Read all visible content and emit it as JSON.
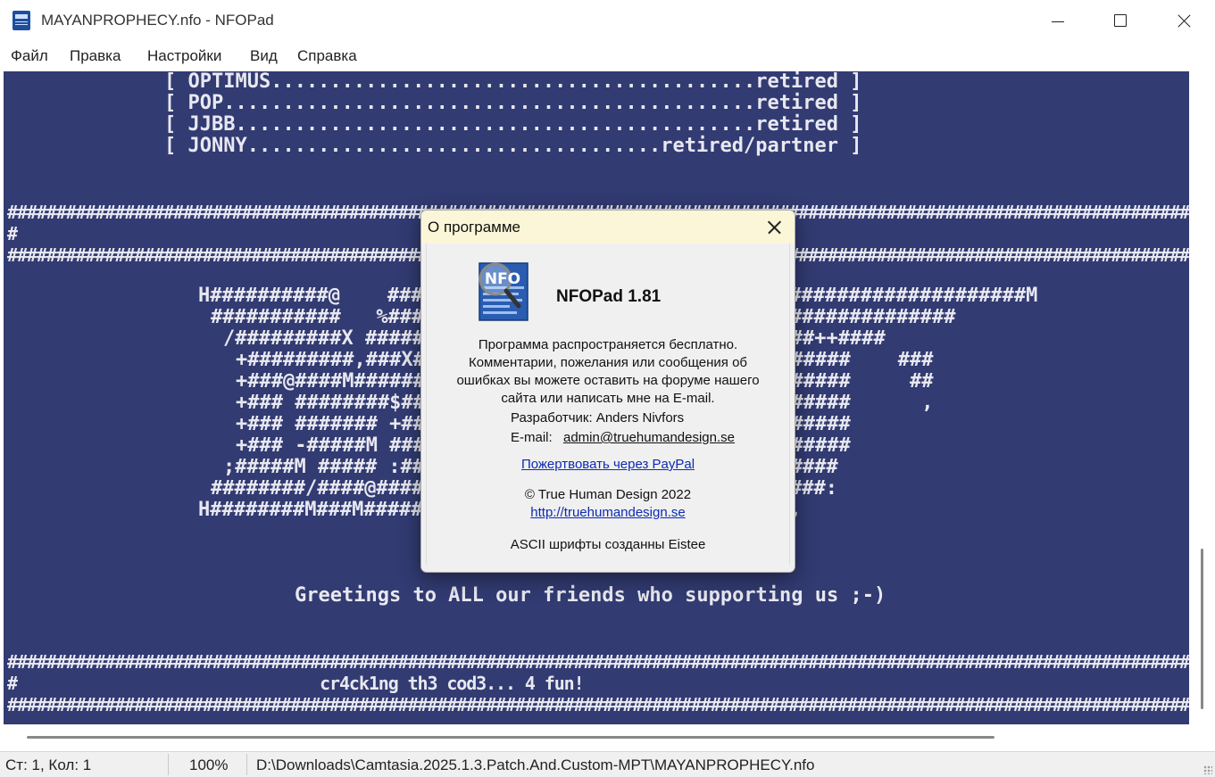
{
  "window": {
    "title": "MAYANPROPHECY.nfo - NFOPad",
    "icon": "nfo-app-icon"
  },
  "menu": [
    "Файл",
    "Правка",
    "Настройки",
    "Вид",
    "Справка"
  ],
  "editor": {
    "background": "#323b72",
    "text_color": "#e8e8f0",
    "lines": [
      "[ OPTIMUS.........................................retired ]",
      "[ POP.............................................retired ]",
      "[ JJBB............................................retired ]",
      "[ JONNY...................................retired/partner ]",
      "############################################################################################################################",
      "#                                                                                                                          #",
      "############################################################################################################################",
      "H##########@    ######################################################M",
      "###########   %################################################",
      "/#########X ##############################%+######++####",
      "+#########,###X####                       .   ######    ###",
      "+###@####M######                              ######     ##",
      "+### ########$####                            ######      ,",
      "+### ####### +###                             ######",
      "+### -#####M ###                              ######",
      ";#####M ##### :###                          $#######",
      "########/####@####                       -##########:",
      "H########M###M####################################,",
      "",
      "Greetings to ALL our friends who supporting us ;-)",
      "############################################################################################################################",
      "#                               cr4ck1ng th3 cod3... 4 fun!                                                                #",
      "############################################################################################################################"
    ]
  },
  "status": {
    "position": "Ст: 1, Кол: 1",
    "zoom": "100%",
    "path": "D:\\Downloads\\Camtasia.2025.1.3.Patch.And.Custom-MPT\\MAYANPROPHECY.nfo"
  },
  "about": {
    "title": "О программе",
    "product": "NFOPad 1.81",
    "description": [
      "Программа распространяется бесплатно.",
      "Комментарии, пожелания или сообщения об",
      "ошибках вы можете оставить на форуме нашего",
      "сайта или написать мне на E-mail."
    ],
    "developer": "Разработчик: Anders Nivfors",
    "email_label": "E-mail:",
    "email": "admin@truehumandesign.se",
    "donate": "Пожертвовать через PayPal",
    "copyright": "© True Human Design 2022",
    "website": "http://truehumandesign.se",
    "fonts_credit": "ASCII шрифты созданны Eistee",
    "logo_text": "NFO"
  }
}
